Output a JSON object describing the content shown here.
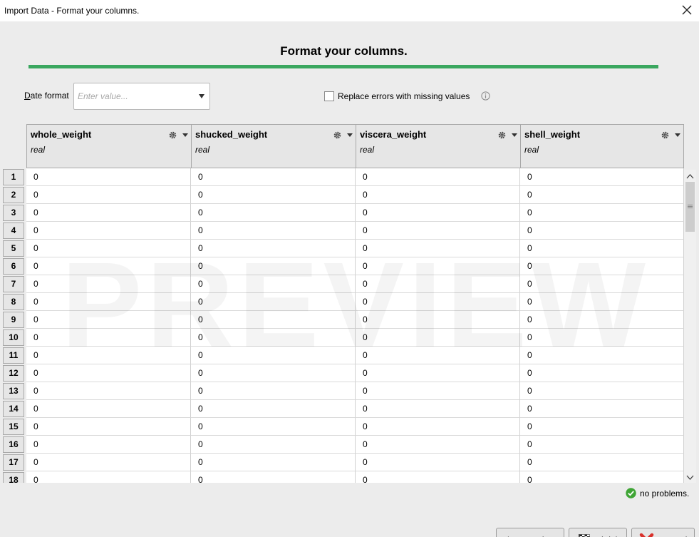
{
  "window": {
    "title": "Import Data - Format your columns."
  },
  "heading": "Format your columns.",
  "date_format": {
    "label_first": "D",
    "label_rest": "ate format",
    "placeholder": "Enter value..."
  },
  "replace_errors": {
    "label": "Replace errors with missing values",
    "checked": false
  },
  "columns": [
    {
      "name": "whole_weight",
      "type": "real"
    },
    {
      "name": "shucked_weight",
      "type": "real"
    },
    {
      "name": "viscera_weight",
      "type": "real"
    },
    {
      "name": "shell_weight",
      "type": "real"
    }
  ],
  "rows": [
    {
      "num": "1",
      "cells": [
        "0",
        "0",
        "0",
        "0"
      ]
    },
    {
      "num": "2",
      "cells": [
        "0",
        "0",
        "0",
        "0"
      ]
    },
    {
      "num": "3",
      "cells": [
        "0",
        "0",
        "0",
        "0"
      ]
    },
    {
      "num": "4",
      "cells": [
        "0",
        "0",
        "0",
        "0"
      ]
    },
    {
      "num": "5",
      "cells": [
        "0",
        "0",
        "0",
        "0"
      ]
    },
    {
      "num": "6",
      "cells": [
        "0",
        "0",
        "0",
        "0"
      ]
    },
    {
      "num": "7",
      "cells": [
        "0",
        "0",
        "0",
        "0"
      ]
    },
    {
      "num": "8",
      "cells": [
        "0",
        "0",
        "0",
        "0"
      ]
    },
    {
      "num": "9",
      "cells": [
        "0",
        "0",
        "0",
        "0"
      ]
    },
    {
      "num": "10",
      "cells": [
        "0",
        "0",
        "0",
        "0"
      ]
    },
    {
      "num": "11",
      "cells": [
        "0",
        "0",
        "0",
        "0"
      ]
    },
    {
      "num": "12",
      "cells": [
        "0",
        "0",
        "0",
        "0"
      ]
    },
    {
      "num": "13",
      "cells": [
        "0",
        "0",
        "0",
        "0"
      ]
    },
    {
      "num": "14",
      "cells": [
        "0",
        "0",
        "0",
        "0"
      ]
    },
    {
      "num": "15",
      "cells": [
        "0",
        "0",
        "0",
        "0"
      ]
    },
    {
      "num": "16",
      "cells": [
        "0",
        "0",
        "0",
        "0"
      ]
    },
    {
      "num": "17",
      "cells": [
        "0",
        "0",
        "0",
        "0"
      ]
    },
    {
      "num": "18",
      "cells": [
        "0",
        "0",
        "0",
        "0"
      ]
    }
  ],
  "watermark": "PREVIEW",
  "status": {
    "text": "no problems.",
    "color": "#3fa535"
  },
  "buttons": {
    "previous": {
      "mnemonic": "P",
      "rest": "revious"
    },
    "finish": {
      "mnemonic": "F",
      "rest": "inish"
    },
    "cancel": {
      "mnemonic": "C",
      "rest": "ancel"
    }
  },
  "colors": {
    "accent_bar": "#3aa75f",
    "cancel_x": "#d9312b"
  }
}
